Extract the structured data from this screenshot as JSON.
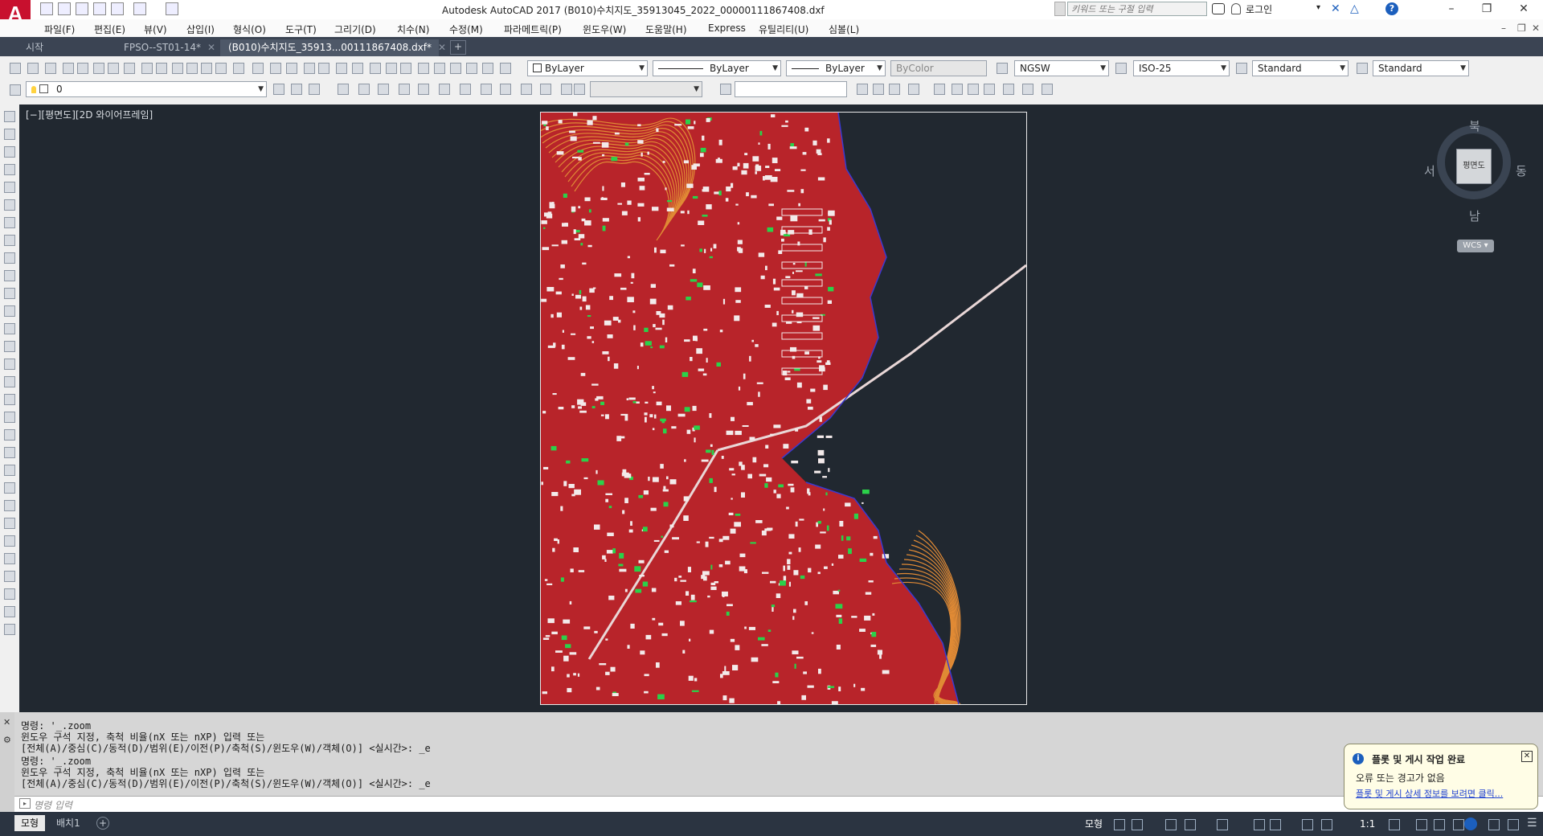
{
  "app": {
    "title": "Autodesk AutoCAD 2017    (B010)수치지도_35913045_2022_00000111867408.dxf",
    "logo_letter": "A",
    "search_placeholder": "키워드 또는 구절 입력",
    "login_label": "로그인"
  },
  "menu": [
    "파일(F)",
    "편집(E)",
    "뷰(V)",
    "삽입(I)",
    "형식(O)",
    "도구(T)",
    "그리기(D)",
    "치수(N)",
    "수정(M)",
    "파라메트릭(P)",
    "윈도우(W)",
    "도움말(H)",
    "Express",
    "유틸리티(U)",
    "심볼(L)"
  ],
  "tabs": [
    {
      "label": "시작",
      "active": false
    },
    {
      "label": "FPSO--ST01-14*",
      "active": false
    },
    {
      "label": "(B010)수치지도_35913...00111867408.dxf*",
      "active": true
    }
  ],
  "toolbar": {
    "color_combo": "ByLayer",
    "linetype_combo": "ByLayer",
    "lineweight_combo": "ByLayer",
    "plotstyle_combo": "ByColor",
    "textstyle_combo": "NGSW",
    "dimstyle_combo": "ISO-25",
    "tablestyle_combo": "Standard",
    "mleaderstyle_combo": "Standard",
    "layer_combo": "0"
  },
  "viewport": {
    "label": "[−][평면도][2D 와이어프레임]"
  },
  "viewcube": {
    "north": "북",
    "south": "남",
    "east": "동",
    "west": "서",
    "face": "평면도",
    "wcs": "WCS"
  },
  "command_history": [
    "명령: '_.zoom",
    "윈도우 구석 지정, 축척 비율(nX 또는 nXP) 입력 또는",
    "[전체(A)/중심(C)/동적(D)/범위(E)/이전(P)/축척(S)/윈도우(W)/객체(O)] <실시간>: _e",
    "명령: '_.zoom",
    "윈도우 구석 지정, 축척 비율(nX 또는 nXP) 입력 또는",
    "[전체(A)/중심(C)/동적(D)/범위(E)/이전(P)/축척(S)/윈도우(W)/객체(O)] <실시간>: _e"
  ],
  "command_placeholder": "명령 입력",
  "layout_tabs": [
    {
      "label": "모형",
      "active": true
    },
    {
      "label": "배치1",
      "active": false
    }
  ],
  "status": {
    "model_label": "모형",
    "scale_label": "1:1"
  },
  "balloon": {
    "title": "플롯 및 게시 작업 완료",
    "body": "오류 또는 경고가 없음",
    "link": "플롯 및 게시 상세 정보를 보려면 클릭..."
  },
  "colors": {
    "drawing_bg": "#212830",
    "map_red": "#c52a2a",
    "contour_orange": "#d97a2b",
    "water": "#212830",
    "accent_blue": "#1c5fbd"
  }
}
